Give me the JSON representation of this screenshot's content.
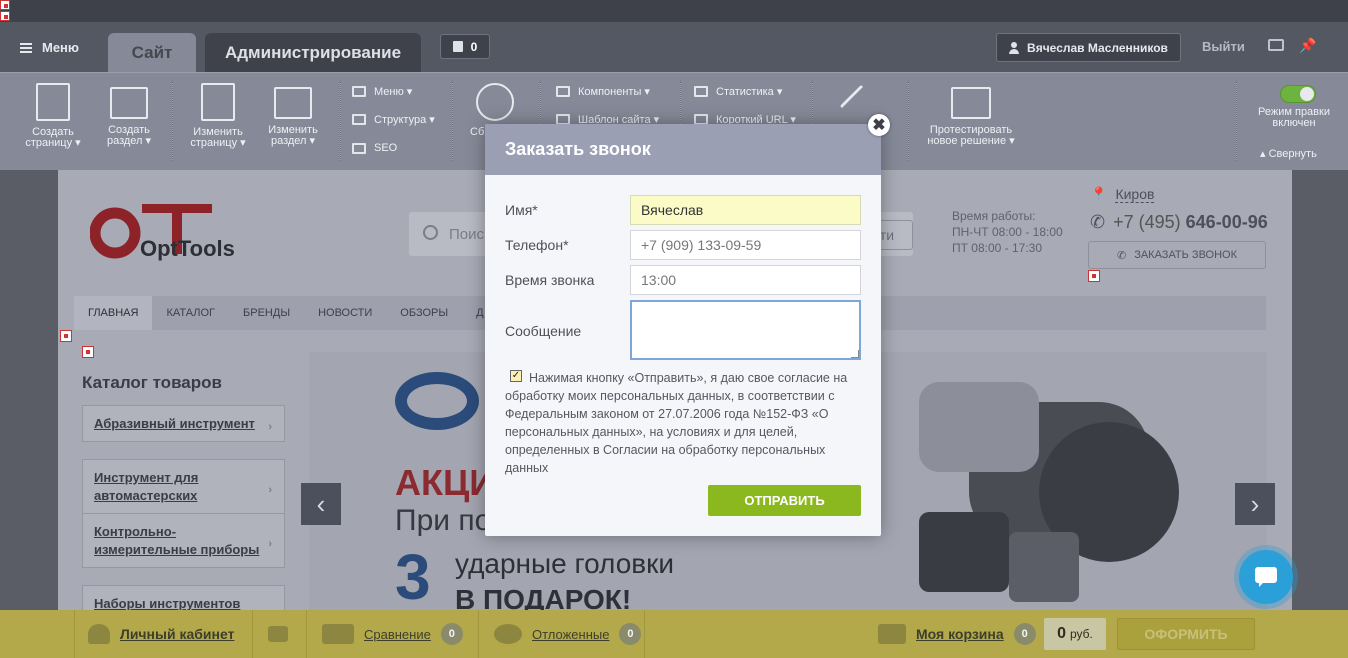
{
  "admin": {
    "menu_label": "Меню",
    "tab_site": "Сайт",
    "tab_admin": "Администрирование",
    "notifications_count": "0",
    "user_name": "Вячеслав Масленников",
    "logout_label": "Выйти"
  },
  "toolbar": {
    "create_page_1": "Создать",
    "create_page_2": "страницу ▾",
    "create_section_1": "Создать",
    "create_section_2": "раздел ▾",
    "edit_page_1": "Изменить",
    "edit_page_2": "страницу ▾",
    "edit_section_1": "Изменить",
    "edit_section_2": "раздел ▾",
    "menu": "Меню ▾",
    "structure": "Структура ▾",
    "seo": "SEO",
    "reset_cache_1": "Сб",
    "components": "Компоненты ▾",
    "site_template": "Шаблон сайта ▾",
    "statistics": "Статистика ▾",
    "short_url": "Короткий URL ▾",
    "test_solution_1": "Протестировать",
    "test_solution_2": "новое решение ▾",
    "edit_mode_1": "Режим правки",
    "edit_mode_2": "включен",
    "collapse": "Свернуть",
    "edit_mode_on": true
  },
  "site": {
    "search_placeholder": "Поис",
    "search_button": "йти",
    "hours_title": "Время работы:",
    "hours_weekdays": "ПН-ЧТ 08:00 - 18:00",
    "hours_friday": "ПТ 08:00 - 17:30",
    "city": "Киров",
    "phone_prefix": "+7 (495)",
    "phone_number": "646-00-96",
    "callback_button": "ЗАКАЗАТЬ ЗВОНОК",
    "nav": [
      "ГЛАВНАЯ",
      "КАТАЛОГ",
      "БРЕНДЫ",
      "НОВОСТИ",
      "ОБЗОРЫ",
      "Д"
    ],
    "catalog_title": "Каталог товаров",
    "catalog_items": [
      "Абразивный инструмент",
      "Инструмент для автомастерских",
      "Контрольно-измерительные приборы",
      "Наборы инструментов"
    ],
    "banner_promo": "АКЦИ",
    "banner_line2": "При по",
    "banner_number": "3",
    "banner_line3": "ударные головки",
    "banner_line4": "В ПОДАРОК!",
    "logo_text": "OptTools"
  },
  "bottom": {
    "account": "Личный кабинет",
    "compare": "Сравнение",
    "compare_count": "0",
    "deferred": "Отложенные",
    "deferred_count": "0",
    "cart": "Моя корзина",
    "cart_count": "0",
    "sum_value": "0",
    "sum_currency": "руб.",
    "checkout": "ОФОРМИТЬ"
  },
  "modal": {
    "title": "Заказать звонок",
    "name_label": "Имя*",
    "name_value": "Вячеслав",
    "phone_label": "Телефон*",
    "phone_placeholder": "+7 (909) 133-09-59",
    "time_label": "Время звонка",
    "time_placeholder": "13:00",
    "message_label": "Сообщение",
    "consent_text": "Нажимая кнопку «Отправить», я даю свое согласие на обработку моих персональных данных, в соответствии с Федеральным законом от 27.07.2006 года №152-ФЗ «О персональных данных», на условиях и для целей, определенных в Согласии на обработку персональных данных",
    "consent_checked": true,
    "submit_label": "ОТПРАВИТЬ"
  },
  "colors": {
    "accent_green": "#8bb81f",
    "modal_header": "#9b9fb4",
    "bottom_bar": "#b3a94b"
  }
}
